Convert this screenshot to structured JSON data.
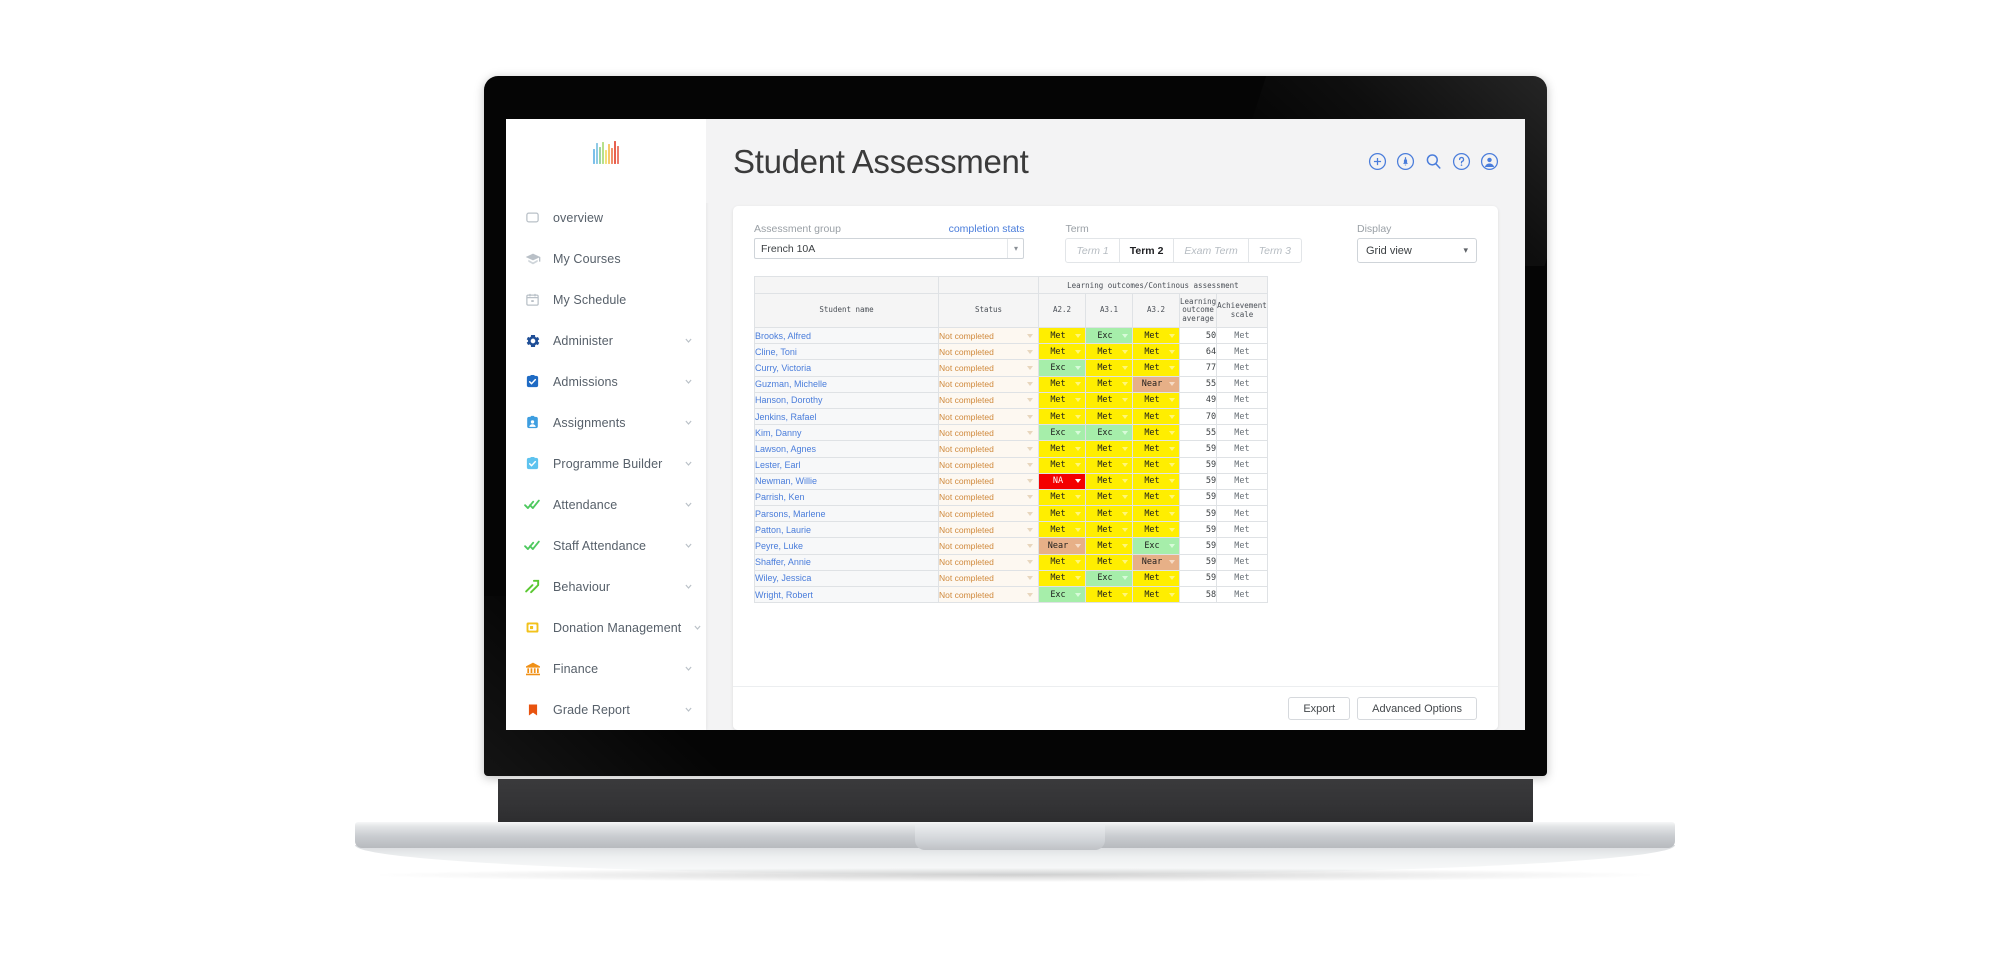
{
  "brand": {
    "logo_name": "rainbow-bars-logo",
    "logo_colors": [
      "#6cb6e8",
      "#8ecae6",
      "#9ed6a0",
      "#b7e08a",
      "#f2e07a",
      "#f7c96b",
      "#ef8f6a",
      "#e8604f",
      "#ec7b6b"
    ]
  },
  "header": {
    "title": "Student Assessment",
    "icons": [
      {
        "name": "add-icon",
        "label": "Add"
      },
      {
        "name": "notifications-icon",
        "label": "Notifications"
      },
      {
        "name": "search-icon",
        "label": "Search"
      },
      {
        "name": "help-icon",
        "label": "Help"
      },
      {
        "name": "account-icon",
        "label": "Account"
      }
    ],
    "accent_color": "#4a7ddb"
  },
  "sidebar": {
    "items": [
      {
        "label": "overview",
        "icon": "square-outline-icon",
        "expandable": false
      },
      {
        "label": "My Courses",
        "icon": "graduation-cap-icon",
        "expandable": false
      },
      {
        "label": "My Schedule",
        "icon": "calendar-icon",
        "expandable": false
      },
      {
        "label": "Administer",
        "icon": "gear-icon",
        "expandable": true
      },
      {
        "label": "Admissions",
        "icon": "clipboard-check-icon",
        "expandable": true
      },
      {
        "label": "Assignments",
        "icon": "id-badge-icon",
        "expandable": true
      },
      {
        "label": "Programme Builder",
        "icon": "clipboard-check-light-icon",
        "expandable": true
      },
      {
        "label": "Attendance",
        "icon": "double-check-icon",
        "expandable": true
      },
      {
        "label": "Staff Attendance",
        "icon": "double-check-icon",
        "expandable": true
      },
      {
        "label": "Behaviour",
        "icon": "trend-lines-icon",
        "expandable": true
      },
      {
        "label": "Donation Management",
        "icon": "wallet-icon",
        "expandable": true
      },
      {
        "label": "Finance",
        "icon": "bank-icon",
        "expandable": true
      },
      {
        "label": "Grade Report",
        "icon": "bookmark-icon",
        "expandable": true
      }
    ]
  },
  "filters": {
    "assessment_group": {
      "label": "Assessment group",
      "value": "French 10A",
      "link_label": "completion stats"
    },
    "term": {
      "label": "Term",
      "options": [
        "Term 1",
        "Term 2",
        "Exam Term",
        "Term 3"
      ],
      "selected": "Term 2"
    },
    "display": {
      "label": "Display",
      "value": "Grid view",
      "options": [
        "Grid view"
      ]
    }
  },
  "table": {
    "group_header": "Learning outcomes/Continous assessment",
    "columns": {
      "name": "Student name",
      "status": "Status",
      "outcomes": [
        "A2.2",
        "A3.1",
        "A3.2"
      ],
      "average": "Learning outcome average",
      "achievement": "Achievement scale"
    },
    "rows": [
      {
        "name": "Brooks, Alfred",
        "status": "Not completed",
        "outcomes": [
          "Met",
          "Exc",
          "Met"
        ],
        "average": "50",
        "achievement": "Met"
      },
      {
        "name": "Cline, Toni",
        "status": "Not completed",
        "outcomes": [
          "Met",
          "Met",
          "Met"
        ],
        "average": "64",
        "achievement": "Met"
      },
      {
        "name": "Curry, Victoria",
        "status": "Not completed",
        "outcomes": [
          "Exc",
          "Met",
          "Met"
        ],
        "average": "77",
        "achievement": "Met"
      },
      {
        "name": "Guzman, Michelle",
        "status": "Not completed",
        "outcomes": [
          "Met",
          "Met",
          "Near"
        ],
        "average": "55",
        "achievement": "Met"
      },
      {
        "name": "Hanson, Dorothy",
        "status": "Not completed",
        "outcomes": [
          "Met",
          "Met",
          "Met"
        ],
        "average": "49",
        "achievement": "Met"
      },
      {
        "name": "Jenkins, Rafael",
        "status": "Not completed",
        "outcomes": [
          "Met",
          "Met",
          "Met"
        ],
        "average": "70",
        "achievement": "Met"
      },
      {
        "name": "Kim, Danny",
        "status": "Not completed",
        "outcomes": [
          "Exc",
          "Exc",
          "Met"
        ],
        "average": "55",
        "achievement": "Met"
      },
      {
        "name": "Lawson, Agnes",
        "status": "Not completed",
        "outcomes": [
          "Met",
          "Met",
          "Met"
        ],
        "average": "59",
        "achievement": "Met"
      },
      {
        "name": "Lester, Earl",
        "status": "Not completed",
        "outcomes": [
          "Met",
          "Met",
          "Met"
        ],
        "average": "59",
        "achievement": "Met"
      },
      {
        "name": "Newman, Willie",
        "status": "Not completed",
        "outcomes": [
          "NA",
          "Met",
          "Met"
        ],
        "average": "59",
        "achievement": "Met"
      },
      {
        "name": "Parrish, Ken",
        "status": "Not completed",
        "outcomes": [
          "Met",
          "Met",
          "Met"
        ],
        "average": "59",
        "achievement": "Met"
      },
      {
        "name": "Parsons, Marlene",
        "status": "Not completed",
        "outcomes": [
          "Met",
          "Met",
          "Met"
        ],
        "average": "59",
        "achievement": "Met"
      },
      {
        "name": "Patton, Laurie",
        "status": "Not completed",
        "outcomes": [
          "Met",
          "Met",
          "Met"
        ],
        "average": "59",
        "achievement": "Met"
      },
      {
        "name": "Peyre, Luke",
        "status": "Not completed",
        "outcomes": [
          "Near",
          "Met",
          "Exc"
        ],
        "average": "59",
        "achievement": "Met"
      },
      {
        "name": "Shaffer, Annie",
        "status": "Not completed",
        "outcomes": [
          "Met",
          "Met",
          "Near"
        ],
        "average": "59",
        "achievement": "Met"
      },
      {
        "name": "Wiley, Jessica",
        "status": "Not completed",
        "outcomes": [
          "Met",
          "Exc",
          "Met"
        ],
        "average": "59",
        "achievement": "Met"
      },
      {
        "name": "Wright, Robert",
        "status": "Not completed",
        "outcomes": [
          "Exc",
          "Met",
          "Met"
        ],
        "average": "58",
        "achievement": "Met"
      }
    ],
    "value_colors": {
      "Met": "#ffee00",
      "Exc": "#a6eeaa",
      "Near": "#e7b087",
      "NA": "#f40000"
    }
  },
  "footer": {
    "export_label": "Export",
    "advanced_label": "Advanced Options"
  }
}
